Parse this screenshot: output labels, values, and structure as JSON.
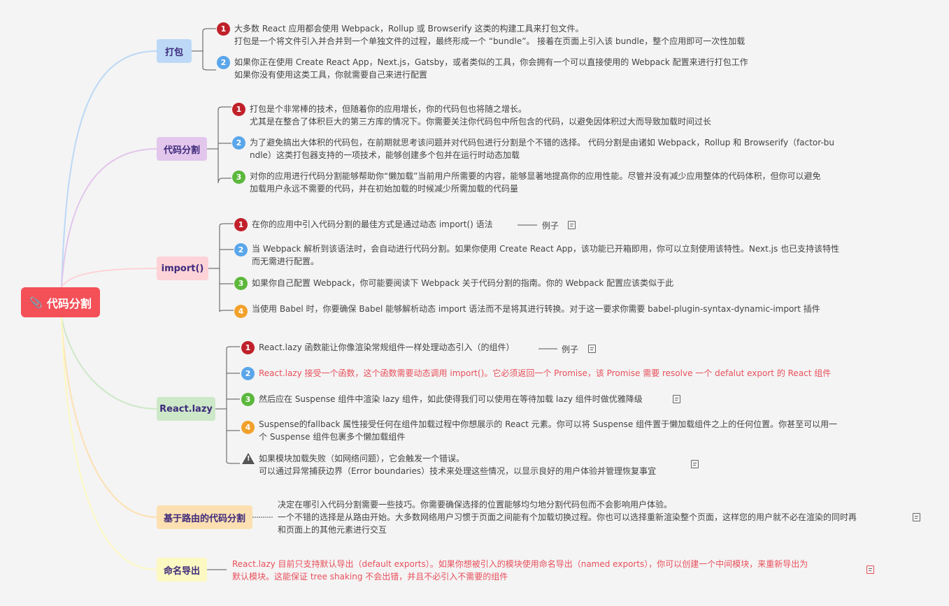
{
  "root": {
    "label": "代码分割",
    "icon": "paperclip-icon",
    "color": "#f35058"
  },
  "branches": [
    {
      "label": "打包",
      "color": "#bcd8f6"
    },
    {
      "label": "代码分割",
      "color": "#e2c6ec"
    },
    {
      "label": "import()",
      "color": "#fdd3d7"
    },
    {
      "label": "React.lazy",
      "color": "#cde8c8"
    },
    {
      "label": "基于路由的代码分割",
      "color": "#fde0b2"
    },
    {
      "label": "命名导出",
      "color": "#fcf8c1"
    }
  ],
  "leaves": {
    "pack_1": [
      "大多数 React 应用都会使用 Webpack，Rollup 或 Browserify 这类的构建工具来打包文件。",
      "打包是一个将文件引入并合并到一个单独文件的过程，最终形成一个 “bundle”。 接着在页面上引入该 bundle，整个应用即可一次性加载"
    ],
    "pack_2": [
      "如果你正在使用 Create React App，Next.js，Gatsby，或者类似的工具，你会拥有一个可以直接使用的 Webpack 配置来进行打包工作",
      "如果你没有使用这类工具，你就需要自己来进行配置"
    ],
    "split_1": [
      "打包是个非常棒的技术，但随着你的应用增长，你的代码包也将随之增长。",
      "尤其是在整合了体积巨大的第三方库的情况下。你需要关注你代码包中所包含的代码，以避免因体积过大而导致加载时间过长"
    ],
    "split_2": [
      "为了避免搞出大体积的代码包，在前期就思考该问题并对代码包进行分割是个不错的选择。 代码分割是由诸如 Webpack，Rollup 和 Browserify（factor-bu",
      "ndle）这类打包器支持的一项技术，能够创建多个包并在运行时动态加载"
    ],
    "split_3": [
      "对你的应用进行代码分割能够帮助你“懒加载”当前用户所需要的内容，能够显著地提高你的应用性能。尽管并没有减少应用整体的代码体积，但你可以避免",
      "加载用户永远不需要的代码，并在初始加载的时候减少所需加载的代码量"
    ],
    "imp_1": [
      "在你的应用中引入代码分割的最佳方式是通过动态 import() 语法"
    ],
    "imp_2": [
      "当 Webpack 解析到该语法时，会自动进行代码分割。如果你使用 Create React App，该功能已开箱即用，你可以立刻使用该特性。Next.js 也已支持该特性",
      "而无需进行配置。"
    ],
    "imp_3": [
      "如果你自己配置 Webpack，你可能要阅读下 Webpack 关于代码分割的指南。你的 Webpack 配置应该类似于此"
    ],
    "imp_4": [
      "当使用 Babel 时，你要确保 Babel 能够解析动态 import 语法而不是将其进行转换。对于这一要求你需要 babel-plugin-syntax-dynamic-import 插件"
    ],
    "lazy_1": [
      "React.lazy 函数能让你像渲染常规组件一样处理动态引入（的组件）"
    ],
    "lazy_2": [
      "React.lazy 接受一个函数，这个函数需要动态调用 import()。它必须返回一个 Promise，该 Promise 需要 resolve 一个 defalut export 的 React 组件"
    ],
    "lazy_3": [
      "然后应在 Suspense 组件中渲染 lazy 组件，如此使得我们可以使用在等待加载 lazy 组件时做优雅降级"
    ],
    "lazy_4": [
      "Suspense的fallback 属性接受任何在组件加载过程中你想展示的 React 元素。你可以将 Suspense 组件置于懒加载组件之上的任何位置。你甚至可以用一",
      "个 Suspense 组件包裹多个懒加载组件"
    ],
    "lazy_5": [
      "如果模块加载失败（如网络问题），它会触发一个错误。",
      "可以通过异常捕获边界（Error boundaries）技术来处理这些情况，以显示良好的用户体验并管理恢复事宜"
    ],
    "route_1": [
      "决定在哪引入代码分割需要一些技巧。你需要确保选择的位置能够均匀地分割代码包而不会影响用户体验。",
      "一个不错的选择是从路由开始。大多数网络用户习惯于页面之间能有个加载切换过程。你也可以选择重新渲染整个页面，这样您的用户就不必在渲染的同时再",
      "和页面上的其他元素进行交互"
    ],
    "named_1": [
      "React.lazy 目前只支持默认导出（default exports）。如果你想被引入的模块使用命名导出（named exports），你可以创建一个中间模块，来重新导出为",
      "默认模块。这能保证 tree shaking 不会出错，并且不必引入不需要的组件"
    ]
  },
  "example_label": "例子",
  "icons": {
    "note": "note-icon",
    "warning": "warning-icon"
  },
  "colors": {
    "text": "#444444",
    "highlight": "#e8505b",
    "background": "#f4f4f4"
  }
}
